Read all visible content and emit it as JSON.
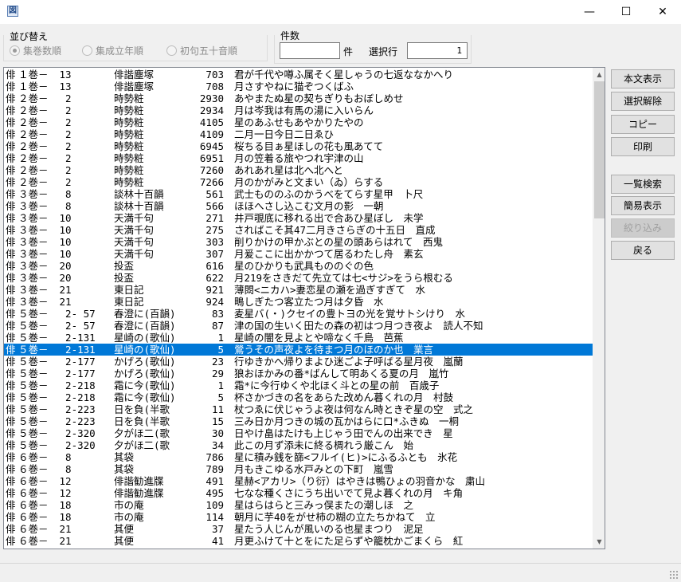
{
  "window": {
    "icon_glyph": "図",
    "controls": {
      "minimize": "—",
      "maximize": "☐",
      "close": "✕"
    }
  },
  "sort": {
    "label": "並び替え",
    "options": [
      {
        "label": "集巻数順",
        "selected": true
      },
      {
        "label": "集成立年順",
        "selected": false
      },
      {
        "label": "初句五十音順",
        "selected": false
      }
    ]
  },
  "count": {
    "label": "件数",
    "value": "",
    "unit": "件",
    "selected_row_label": "選択行",
    "selected_row_value": "1"
  },
  "buttons": {
    "show_text": "本文表示",
    "clear_selection": "選択解除",
    "copy": "コピー",
    "print": "印刷",
    "list_search": "一覧検索",
    "simple_display": "簡易表示",
    "narrow": "絞り込み",
    "back": "戻る"
  },
  "rows": [
    {
      "genre": "俳",
      "vol": "１巻－",
      "sub": " 13",
      "title": "俳諧塵塚",
      "num": "703",
      "verse": "君が千代や噂ふ属そく星しゃうの七返ななかへり"
    },
    {
      "genre": "俳",
      "vol": "１巻－",
      "sub": " 13",
      "title": "俳諧塵塚",
      "num": "708",
      "verse": "月さすやねに猫ぞつくばふ"
    },
    {
      "genre": "俳",
      "vol": "２巻－",
      "sub": "  2",
      "title": "時勢粧",
      "num": "2930",
      "verse": "あやまたぬ星の契ちぎりもおぼしめせ"
    },
    {
      "genre": "俳",
      "vol": "２巻－",
      "sub": "  2",
      "title": "時勢粧",
      "num": "2934",
      "verse": "月は岑我は有馬の湯に入いらん"
    },
    {
      "genre": "俳",
      "vol": "２巻－",
      "sub": "  2",
      "title": "時勢粧",
      "num": "4105",
      "verse": "星のあふせもあやかりたやの"
    },
    {
      "genre": "俳",
      "vol": "２巻－",
      "sub": "  2",
      "title": "時勢粧",
      "num": "4109",
      "verse": "二月一日今日二日ゑひ"
    },
    {
      "genre": "俳",
      "vol": "２巻－",
      "sub": "  2",
      "title": "時勢粧",
      "num": "6945",
      "verse": "桜ちる目ぁ星ほしの花も風あてて"
    },
    {
      "genre": "俳",
      "vol": "２巻－",
      "sub": "  2",
      "title": "時勢粧",
      "num": "6951",
      "verse": "月の笠着る旅やつれ宇津の山"
    },
    {
      "genre": "俳",
      "vol": "２巻－",
      "sub": "  2",
      "title": "時勢粧",
      "num": "7260",
      "verse": "あれあれ星は北へ北へと"
    },
    {
      "genre": "俳",
      "vol": "２巻－",
      "sub": "  2",
      "title": "時勢粧",
      "num": "7266",
      "verse": "月のかがみと文まい（ゐ）らする"
    },
    {
      "genre": "俳",
      "vol": "３巻－",
      "sub": "  8",
      "title": "談林十百韻",
      "num": "561",
      "verse": "武士もののふのかうべをてらす星甲　卜尺"
    },
    {
      "genre": "俳",
      "vol": "３巻－",
      "sub": "  8",
      "title": "談林十百韻",
      "num": "566",
      "verse": "ほほへさし込こむ文月の影　一朝"
    },
    {
      "genre": "俳",
      "vol": "３巻－",
      "sub": " 10",
      "title": "天満千句",
      "num": "271",
      "verse": "井戸覗底に移れる出で合あひ星ぼし　未学"
    },
    {
      "genre": "俳",
      "vol": "３巻－",
      "sub": " 10",
      "title": "天満千句",
      "num": "275",
      "verse": "さればこそ其47二月きさらぎの十五日　直成"
    },
    {
      "genre": "俳",
      "vol": "３巻－",
      "sub": " 10",
      "title": "天満千句",
      "num": "303",
      "verse": "削りかけの甲かぶとの星の頭あらはれて　西鬼"
    },
    {
      "genre": "俳",
      "vol": "３巻－",
      "sub": " 10",
      "title": "天満千句",
      "num": "307",
      "verse": "月爰ここに出かかつて居るわたし舟　素玄"
    },
    {
      "genre": "俳",
      "vol": "３巻－",
      "sub": " 20",
      "title": "投盃",
      "num": "616",
      "verse": "星のひかりも武具もののぐの色"
    },
    {
      "genre": "俳",
      "vol": "３巻－",
      "sub": " 20",
      "title": "投盃",
      "num": "622",
      "verse": "月219をさきだて先立ては七<サジ>をうら根むる"
    },
    {
      "genre": "俳",
      "vol": "３巻－",
      "sub": " 21",
      "title": "東日記",
      "num": "921",
      "verse": "薄閦<ニカハ>妻恋星の瀬を過ぎすぎて　水"
    },
    {
      "genre": "俳",
      "vol": "３巻－",
      "sub": " 21",
      "title": "東日記",
      "num": "924",
      "verse": "鴫しぎたつ客立たつ月は夕昏　水"
    },
    {
      "genre": "俳",
      "vol": "５巻－",
      "sub": "  2- 57",
      "title": "春澄に(百韻)",
      "num": "83",
      "verse": "麦星バ(・)クセイの豊トヨの光を覚サトシけり　水"
    },
    {
      "genre": "俳",
      "vol": "５巻－",
      "sub": "  2- 57",
      "title": "春澄に(百韻)",
      "num": "87",
      "verse": "津の国の生いく田たの森の初はつ月つき夜よ　読人不知"
    },
    {
      "genre": "俳",
      "vol": "５巻－",
      "sub": "  2-131",
      "title": "星崎の(歌仙)",
      "num": "1",
      "verse": "星崎の闇を見よとや啼なく千鳥　芭蕉"
    },
    {
      "genre": "俳",
      "vol": "５巻－",
      "sub": "  2-131",
      "title": "星崎の(歌仙)",
      "num": "5",
      "verse": "鶯うその声夜よを待まつ月のほのか也　業言"
    },
    {
      "genre": "俳",
      "vol": "５巻－",
      "sub": "  2-177",
      "title": "かげろ(歌仙)",
      "num": "23",
      "verse": "行ゆきかへ帰りまよひ迷ごよ子呼ばる星月夜　嵐蘭"
    },
    {
      "genre": "俳",
      "vol": "５巻－",
      "sub": "  2-177",
      "title": "かげろ(歌仙)",
      "num": "29",
      "verse": "狼おほかみの番*ばんして明あくる夏の月　嵐竹"
    },
    {
      "genre": "俳",
      "vol": "５巻－",
      "sub": "  2-218",
      "title": "霜に今(歌仙)",
      "num": "1",
      "verse": "霜*に今行ゆくや北ほく斗との星の前　百歳子"
    },
    {
      "genre": "俳",
      "vol": "５巻－",
      "sub": "  2-218",
      "title": "霜に今(歌仙)",
      "num": "5",
      "verse": "杯さかづきの名をあらた改めん暮くれの月　村鼓"
    },
    {
      "genre": "俳",
      "vol": "５巻－",
      "sub": "  2-223",
      "title": "日を負(半歌",
      "num": "11",
      "verse": "杖つゑに伏じゃうよ夜は何なん時ときぞ星の空　式之"
    },
    {
      "genre": "俳",
      "vol": "５巻－",
      "sub": "  2-223",
      "title": "日を負(半歌",
      "num": "15",
      "verse": "三み日か月つきの城の瓦かはらに口*ふきぬ　一桐"
    },
    {
      "genre": "俳",
      "vol": "５巻－",
      "sub": "  2-320",
      "title": "夕がほ二(歌",
      "num": "30",
      "verse": "日やけ畠はたけも上じゃう田でんの出来でき　星"
    },
    {
      "genre": "俳",
      "vol": "５巻－",
      "sub": "  2-320",
      "title": "夕がほ二(歌",
      "num": "34",
      "verse": "此この月ず添未に終る椆れう厳こん　始"
    },
    {
      "genre": "俳",
      "vol": "６巻－",
      "sub": "  8",
      "title": "其袋",
      "num": "786",
      "verse": "星に積み銭を篩<フルイ(ヒ)>にふるふとも　氷花"
    },
    {
      "genre": "俳",
      "vol": "６巻－",
      "sub": "  8",
      "title": "其袋",
      "num": "789",
      "verse": "月もきこゆる水戸みとの下町　嵐雪"
    },
    {
      "genre": "俳",
      "vol": "６巻－",
      "sub": " 12",
      "title": "俳諧勧進牒",
      "num": "491",
      "verse": "星赫<アカリ>（り衍）はやきは鴨ひょの羽音かな　粛山"
    },
    {
      "genre": "俳",
      "vol": "６巻－",
      "sub": " 12",
      "title": "俳諧勧進牒",
      "num": "495",
      "verse": "七なな種くさにうち出いでて見よ暮くれの月　キ角"
    },
    {
      "genre": "俳",
      "vol": "６巻－",
      "sub": " 18",
      "title": "市の庵",
      "num": "109",
      "verse": "星はらはらと三みっ俣またの潮しほ　之"
    },
    {
      "genre": "俳",
      "vol": "６巻－",
      "sub": " 18",
      "title": "市の庵",
      "num": "114",
      "verse": "朝月に芋40をがせ柿の糊の立たちかねて　立"
    },
    {
      "genre": "俳",
      "vol": "６巻－",
      "sub": " 21",
      "title": "其便",
      "num": "37",
      "verse": "星たう人じんが風いのる也星まつり　泥足"
    },
    {
      "genre": "俳",
      "vol": "６巻－",
      "sub": " 21",
      "title": "其便",
      "num": "41",
      "verse": "月更ふけて十とをにた足らずや籠枕かごまくら　紅"
    }
  ],
  "selected_index": 23
}
